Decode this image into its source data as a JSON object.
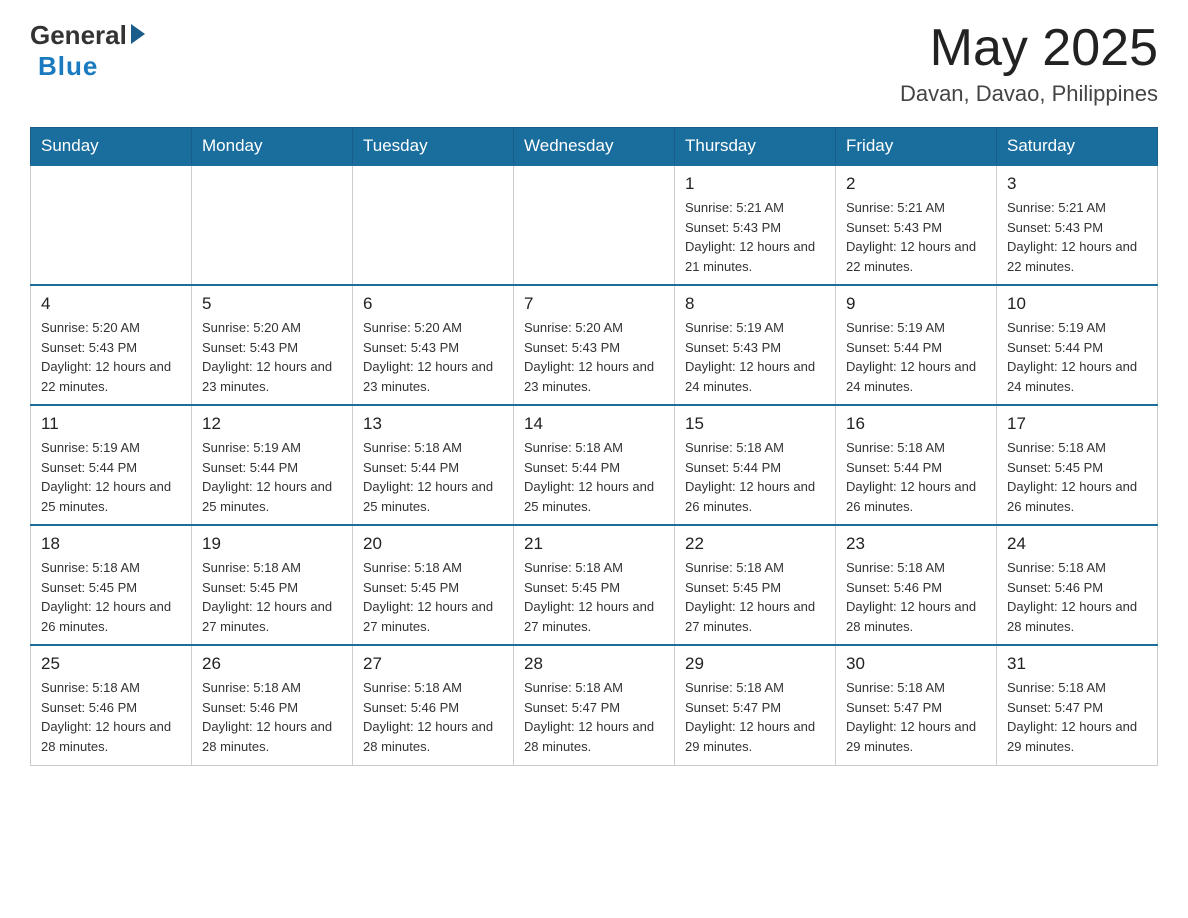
{
  "header": {
    "logo_general": "General",
    "logo_blue": "Blue",
    "month_title": "May 2025",
    "location": "Davan, Davao, Philippines"
  },
  "days_of_week": [
    "Sunday",
    "Monday",
    "Tuesday",
    "Wednesday",
    "Thursday",
    "Friday",
    "Saturday"
  ],
  "weeks": [
    [
      {
        "day": "",
        "info": ""
      },
      {
        "day": "",
        "info": ""
      },
      {
        "day": "",
        "info": ""
      },
      {
        "day": "",
        "info": ""
      },
      {
        "day": "1",
        "info": "Sunrise: 5:21 AM\nSunset: 5:43 PM\nDaylight: 12 hours and 21 minutes."
      },
      {
        "day": "2",
        "info": "Sunrise: 5:21 AM\nSunset: 5:43 PM\nDaylight: 12 hours and 22 minutes."
      },
      {
        "day": "3",
        "info": "Sunrise: 5:21 AM\nSunset: 5:43 PM\nDaylight: 12 hours and 22 minutes."
      }
    ],
    [
      {
        "day": "4",
        "info": "Sunrise: 5:20 AM\nSunset: 5:43 PM\nDaylight: 12 hours and 22 minutes."
      },
      {
        "day": "5",
        "info": "Sunrise: 5:20 AM\nSunset: 5:43 PM\nDaylight: 12 hours and 23 minutes."
      },
      {
        "day": "6",
        "info": "Sunrise: 5:20 AM\nSunset: 5:43 PM\nDaylight: 12 hours and 23 minutes."
      },
      {
        "day": "7",
        "info": "Sunrise: 5:20 AM\nSunset: 5:43 PM\nDaylight: 12 hours and 23 minutes."
      },
      {
        "day": "8",
        "info": "Sunrise: 5:19 AM\nSunset: 5:43 PM\nDaylight: 12 hours and 24 minutes."
      },
      {
        "day": "9",
        "info": "Sunrise: 5:19 AM\nSunset: 5:44 PM\nDaylight: 12 hours and 24 minutes."
      },
      {
        "day": "10",
        "info": "Sunrise: 5:19 AM\nSunset: 5:44 PM\nDaylight: 12 hours and 24 minutes."
      }
    ],
    [
      {
        "day": "11",
        "info": "Sunrise: 5:19 AM\nSunset: 5:44 PM\nDaylight: 12 hours and 25 minutes."
      },
      {
        "day": "12",
        "info": "Sunrise: 5:19 AM\nSunset: 5:44 PM\nDaylight: 12 hours and 25 minutes."
      },
      {
        "day": "13",
        "info": "Sunrise: 5:18 AM\nSunset: 5:44 PM\nDaylight: 12 hours and 25 minutes."
      },
      {
        "day": "14",
        "info": "Sunrise: 5:18 AM\nSunset: 5:44 PM\nDaylight: 12 hours and 25 minutes."
      },
      {
        "day": "15",
        "info": "Sunrise: 5:18 AM\nSunset: 5:44 PM\nDaylight: 12 hours and 26 minutes."
      },
      {
        "day": "16",
        "info": "Sunrise: 5:18 AM\nSunset: 5:44 PM\nDaylight: 12 hours and 26 minutes."
      },
      {
        "day": "17",
        "info": "Sunrise: 5:18 AM\nSunset: 5:45 PM\nDaylight: 12 hours and 26 minutes."
      }
    ],
    [
      {
        "day": "18",
        "info": "Sunrise: 5:18 AM\nSunset: 5:45 PM\nDaylight: 12 hours and 26 minutes."
      },
      {
        "day": "19",
        "info": "Sunrise: 5:18 AM\nSunset: 5:45 PM\nDaylight: 12 hours and 27 minutes."
      },
      {
        "day": "20",
        "info": "Sunrise: 5:18 AM\nSunset: 5:45 PM\nDaylight: 12 hours and 27 minutes."
      },
      {
        "day": "21",
        "info": "Sunrise: 5:18 AM\nSunset: 5:45 PM\nDaylight: 12 hours and 27 minutes."
      },
      {
        "day": "22",
        "info": "Sunrise: 5:18 AM\nSunset: 5:45 PM\nDaylight: 12 hours and 27 minutes."
      },
      {
        "day": "23",
        "info": "Sunrise: 5:18 AM\nSunset: 5:46 PM\nDaylight: 12 hours and 28 minutes."
      },
      {
        "day": "24",
        "info": "Sunrise: 5:18 AM\nSunset: 5:46 PM\nDaylight: 12 hours and 28 minutes."
      }
    ],
    [
      {
        "day": "25",
        "info": "Sunrise: 5:18 AM\nSunset: 5:46 PM\nDaylight: 12 hours and 28 minutes."
      },
      {
        "day": "26",
        "info": "Sunrise: 5:18 AM\nSunset: 5:46 PM\nDaylight: 12 hours and 28 minutes."
      },
      {
        "day": "27",
        "info": "Sunrise: 5:18 AM\nSunset: 5:46 PM\nDaylight: 12 hours and 28 minutes."
      },
      {
        "day": "28",
        "info": "Sunrise: 5:18 AM\nSunset: 5:47 PM\nDaylight: 12 hours and 28 minutes."
      },
      {
        "day": "29",
        "info": "Sunrise: 5:18 AM\nSunset: 5:47 PM\nDaylight: 12 hours and 29 minutes."
      },
      {
        "day": "30",
        "info": "Sunrise: 5:18 AM\nSunset: 5:47 PM\nDaylight: 12 hours and 29 minutes."
      },
      {
        "day": "31",
        "info": "Sunrise: 5:18 AM\nSunset: 5:47 PM\nDaylight: 12 hours and 29 minutes."
      }
    ]
  ]
}
